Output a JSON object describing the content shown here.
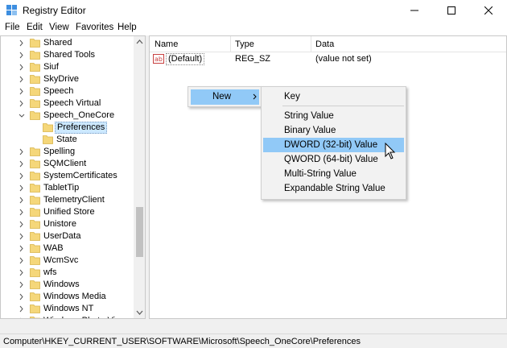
{
  "window": {
    "title": "Registry Editor"
  },
  "menu": [
    "File",
    "Edit",
    "View",
    "Favorites",
    "Help"
  ],
  "tree": {
    "items": [
      {
        "label": "Shared",
        "expanded": false
      },
      {
        "label": "Shared Tools",
        "expanded": false
      },
      {
        "label": "Siuf",
        "expanded": false
      },
      {
        "label": "SkyDrive",
        "expanded": false
      },
      {
        "label": "Speech",
        "expanded": false
      },
      {
        "label": "Speech Virtual",
        "expanded": false
      },
      {
        "label": "Speech_OneCore",
        "expanded": true
      },
      {
        "label": "Preferences",
        "child": true,
        "selected": true
      },
      {
        "label": "State",
        "child": true
      },
      {
        "label": "Spelling",
        "expanded": false
      },
      {
        "label": "SQMClient",
        "expanded": false
      },
      {
        "label": "SystemCertificates",
        "expanded": false
      },
      {
        "label": "TabletTip",
        "expanded": false
      },
      {
        "label": "TelemetryClient",
        "expanded": false
      },
      {
        "label": "Unified Store",
        "expanded": false
      },
      {
        "label": "Unistore",
        "expanded": false
      },
      {
        "label": "UserData",
        "expanded": false
      },
      {
        "label": "WAB",
        "expanded": false
      },
      {
        "label": "WcmSvc",
        "expanded": false
      },
      {
        "label": "wfs",
        "expanded": false
      },
      {
        "label": "Windows",
        "expanded": false
      },
      {
        "label": "Windows Media",
        "expanded": false
      },
      {
        "label": "Windows NT",
        "expanded": false
      },
      {
        "label": "Windows Photo Viewer",
        "expanded": false
      }
    ]
  },
  "list": {
    "columns": [
      "Name",
      "Type",
      "Data"
    ],
    "rows": [
      {
        "name": "(Default)",
        "type": "REG_SZ",
        "data": "(value not set)",
        "icon": "string-value-icon"
      }
    ]
  },
  "context_menu": {
    "new_label": "New",
    "submenu": [
      "Key",
      "String Value",
      "Binary Value",
      "DWORD (32-bit) Value",
      "QWORD (64-bit) Value",
      "Multi-String Value",
      "Expandable String Value"
    ],
    "highlighted": "DWORD (32-bit) Value"
  },
  "status": {
    "path": "Computer\\HKEY_CURRENT_USER\\SOFTWARE\\Microsoft\\Speech_OneCore\\Preferences"
  },
  "colors": {
    "highlight": "#91c9f7",
    "folder": "#f5d77a",
    "selection": "#cce8ff"
  }
}
